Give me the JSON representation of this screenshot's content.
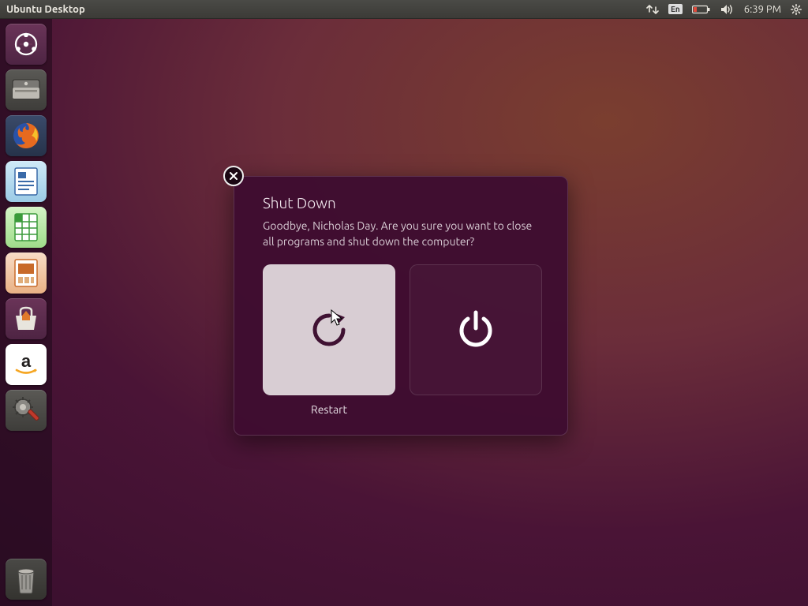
{
  "menubar": {
    "title": "Ubuntu Desktop",
    "keyboard_indicator": "En",
    "clock": "6:39 PM"
  },
  "launcher": {
    "items": [
      {
        "name": "dash",
        "tooltip": "Search your computer"
      },
      {
        "name": "files",
        "tooltip": "Files"
      },
      {
        "name": "firefox",
        "tooltip": "Firefox Web Browser"
      },
      {
        "name": "writer",
        "tooltip": "LibreOffice Writer"
      },
      {
        "name": "calc",
        "tooltip": "LibreOffice Calc"
      },
      {
        "name": "impress",
        "tooltip": "LibreOffice Impress"
      },
      {
        "name": "software",
        "tooltip": "Ubuntu Software"
      },
      {
        "name": "amazon",
        "tooltip": "Amazon"
      },
      {
        "name": "settings",
        "tooltip": "System Settings"
      }
    ],
    "trash_tooltip": "Trash"
  },
  "dialog": {
    "title": "Shut Down",
    "body": "Goodbye, Nicholas Day. Are you sure you want to close all programs and shut down the computer?",
    "restart_label": "Restart",
    "shutdown_label": "Shut Down",
    "selected": "restart"
  }
}
